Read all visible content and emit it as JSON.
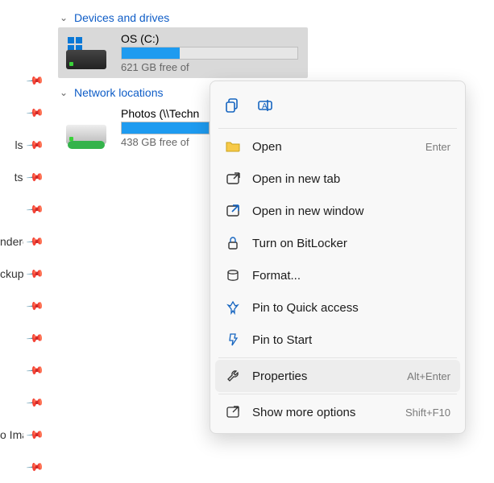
{
  "sidebar": {
    "items": [
      {
        "label": ""
      },
      {
        "label": ""
      },
      {
        "label": "ls"
      },
      {
        "label": "ts"
      },
      {
        "label": ""
      },
      {
        "label": "ndered"
      },
      {
        "label": "ckup"
      },
      {
        "label": ""
      },
      {
        "label": ""
      },
      {
        "label": ""
      },
      {
        "label": ""
      },
      {
        "label": "o Imag"
      },
      {
        "label": ""
      }
    ]
  },
  "groups": {
    "devices": {
      "label": "Devices and drives"
    },
    "network": {
      "label": "Network locations"
    }
  },
  "drives": [
    {
      "name": "OS (C:)",
      "free_text": "621 GB free of",
      "used_ratio": 0.33,
      "selected": true,
      "type": "os"
    },
    {
      "name": "Photos (\\\\Techn",
      "free_text": "438 GB free of",
      "used_ratio": 1.0,
      "selected": false,
      "type": "network"
    }
  ],
  "context_menu": {
    "toolbar": [
      {
        "icon": "copy-icon",
        "name": "copy"
      },
      {
        "icon": "rename-icon",
        "name": "rename"
      }
    ],
    "items": [
      {
        "icon": "folder-icon",
        "label": "Open",
        "accel": "Enter"
      },
      {
        "icon": "new-tab-icon",
        "label": "Open in new tab",
        "accel": ""
      },
      {
        "icon": "new-win-icon",
        "label": "Open in new window",
        "accel": ""
      },
      {
        "icon": "lock-icon",
        "label": "Turn on BitLocker",
        "accel": ""
      },
      {
        "icon": "format-icon",
        "label": "Format...",
        "accel": ""
      },
      {
        "icon": "pin-qa-icon",
        "label": "Pin to Quick access",
        "accel": ""
      },
      {
        "icon": "pin-start-icon",
        "label": "Pin to Start",
        "accel": ""
      },
      {
        "icon": "wrench-icon",
        "label": "Properties",
        "accel": "Alt+Enter",
        "hovered": true
      },
      {
        "icon": "more-icon",
        "label": "Show more options",
        "accel": "Shift+F10"
      }
    ]
  }
}
